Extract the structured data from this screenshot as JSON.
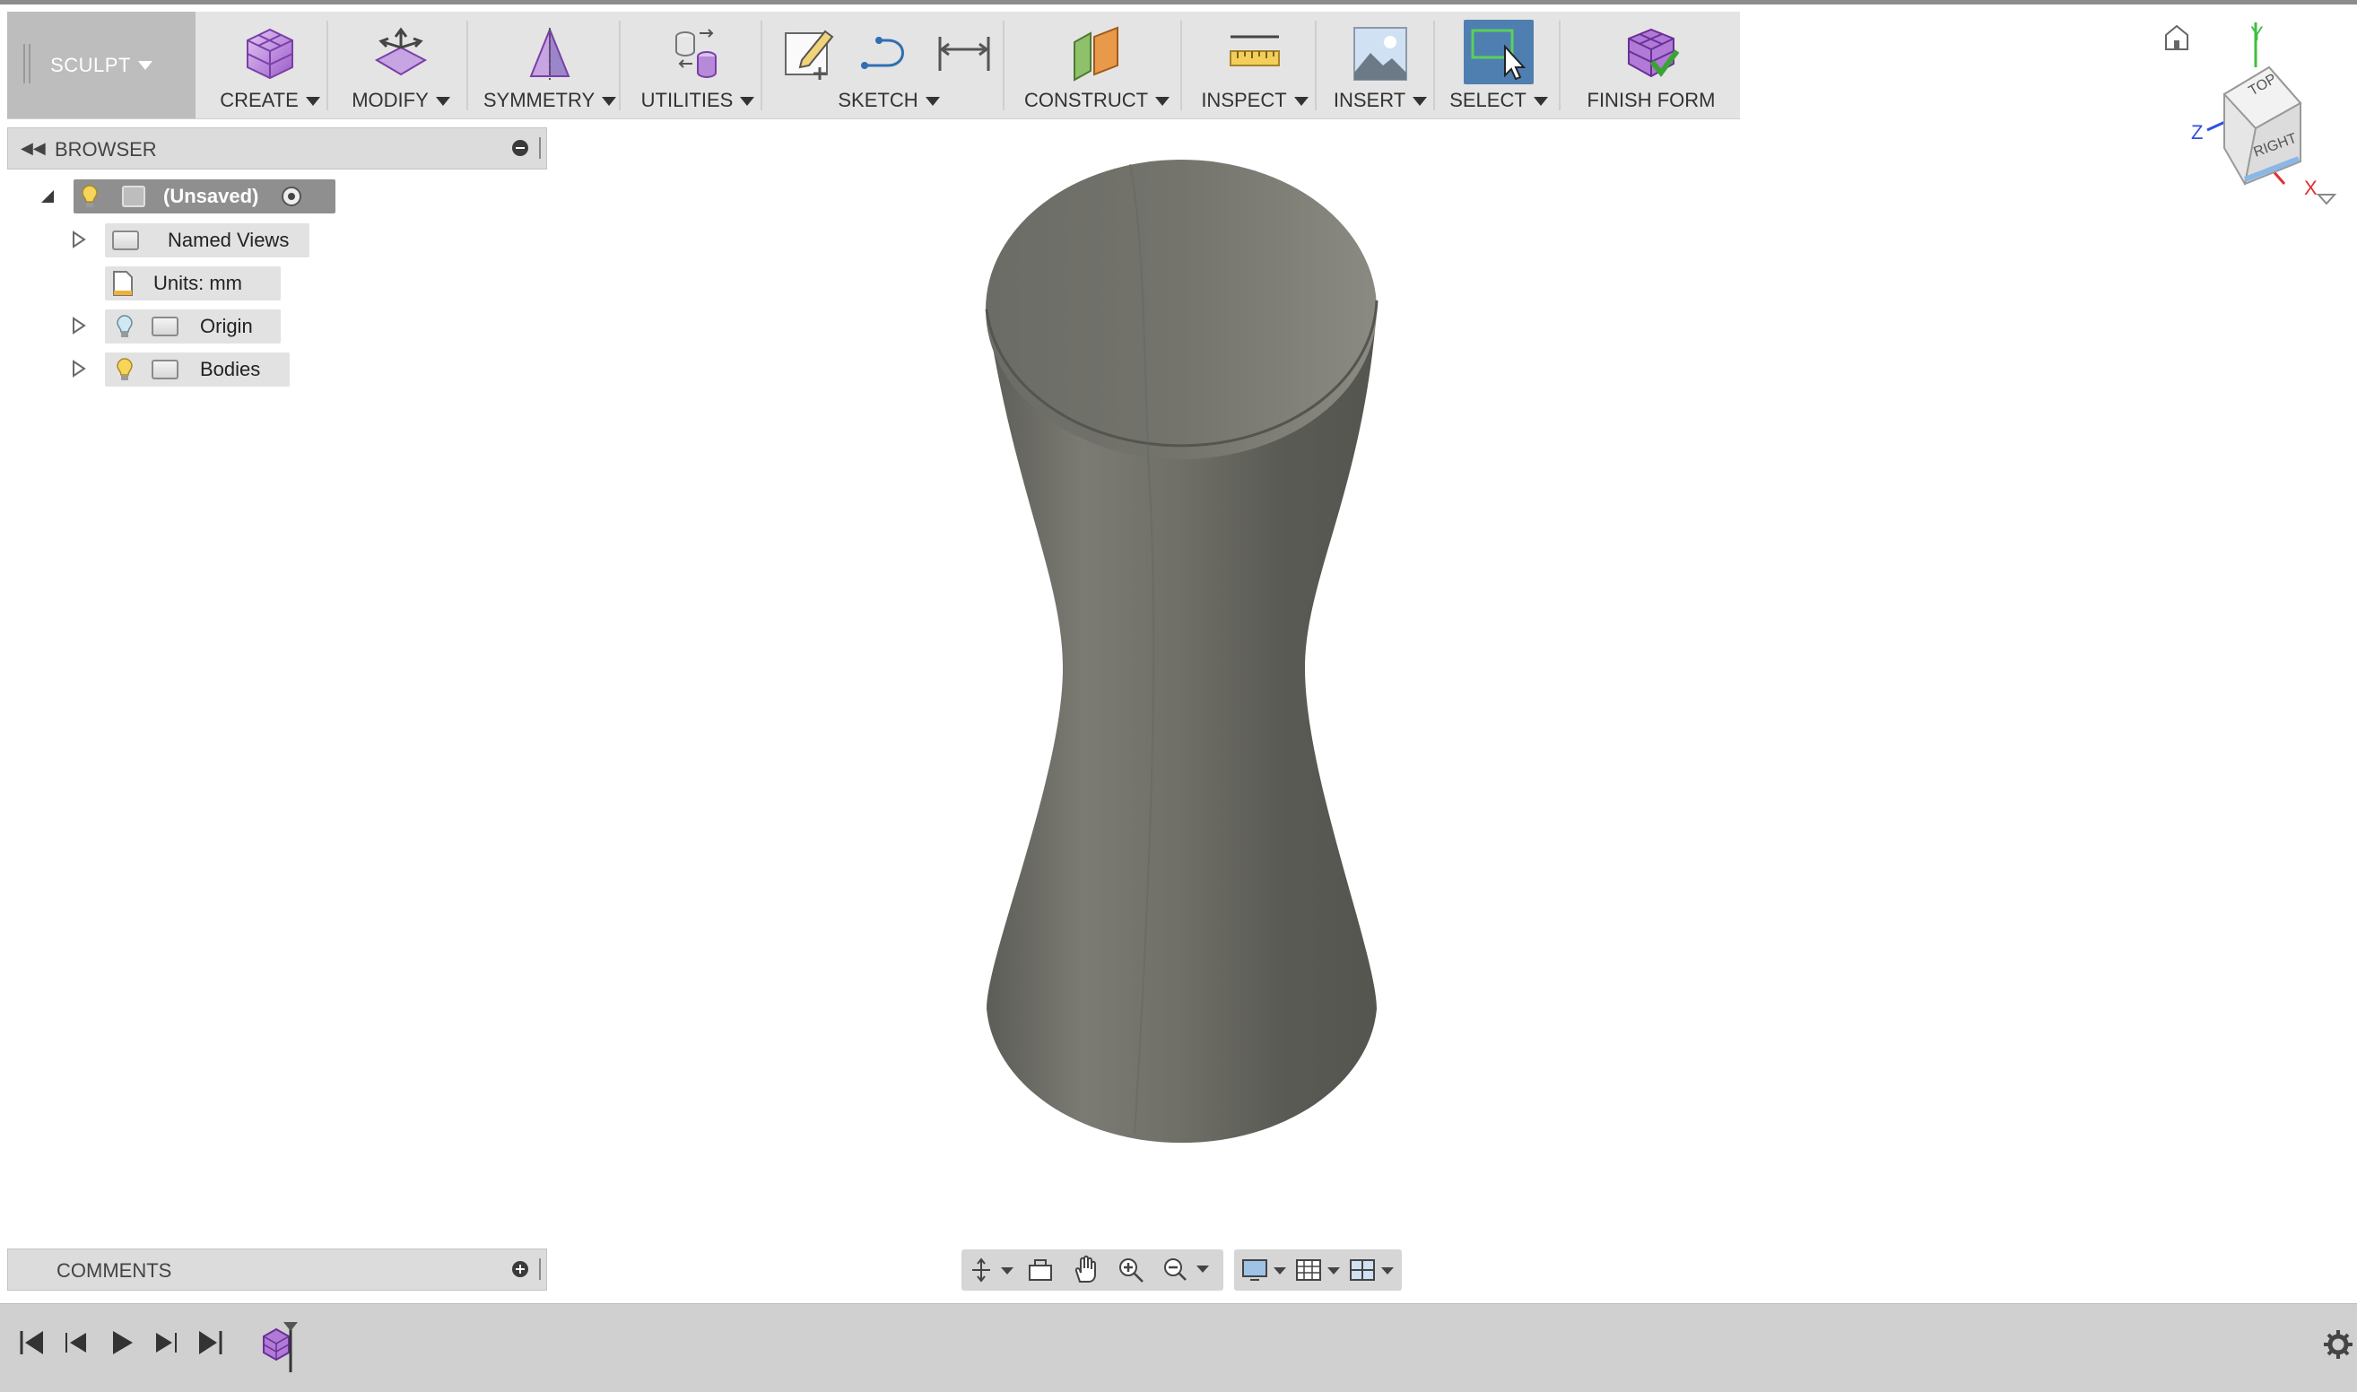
{
  "toolbar": {
    "workspace": "SCULPT",
    "groups": {
      "create": "CREATE",
      "modify": "MODIFY",
      "symmetry": "SYMMETRY",
      "utilities": "UTILITIES",
      "sketch": "SKETCH",
      "construct": "CONSTRUCT",
      "inspect": "INSPECT",
      "insert": "INSERT",
      "select": "SELECT",
      "finish": "FINISH FORM"
    }
  },
  "browser": {
    "title": "BROWSER",
    "root": "(Unsaved)",
    "items": [
      {
        "label": "Named Views"
      },
      {
        "label": "Units: mm"
      },
      {
        "label": "Origin"
      },
      {
        "label": "Bodies"
      }
    ]
  },
  "comments": {
    "title": "COMMENTS"
  },
  "viewcube": {
    "top": "TOP",
    "right": "RIGHT",
    "axis_x": "X",
    "axis_y": "Y",
    "axis_z": "Z"
  },
  "colors": {
    "body": "#6f6f68",
    "accent_select": "#4f7fb0",
    "create_icon": "#b07ad6"
  }
}
